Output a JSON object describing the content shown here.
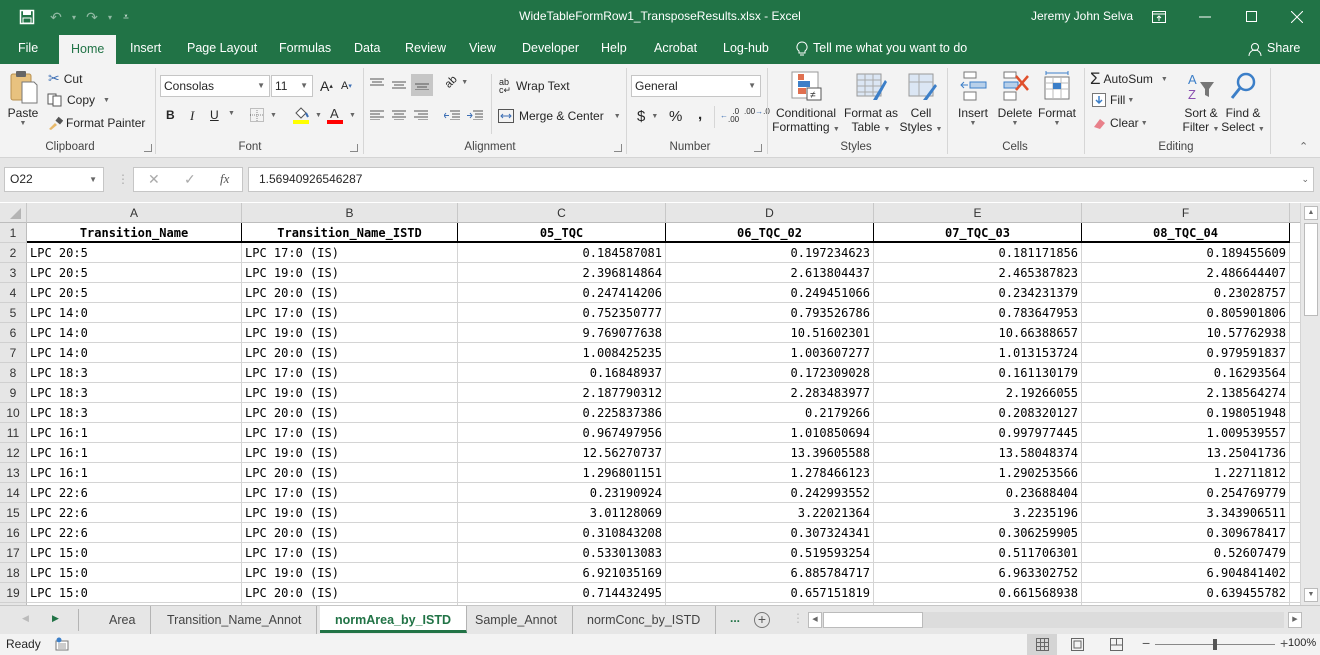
{
  "window": {
    "title": "WideTableFormRow1_TransposeResults.xlsx  -  Excel",
    "user": "Jeremy John Selva"
  },
  "menu": {
    "tabs": [
      "File",
      "Home",
      "Insert",
      "Page Layout",
      "Formulas",
      "Data",
      "Review",
      "View",
      "Developer",
      "Help",
      "Acrobat",
      "Log-hub"
    ],
    "tell_me": "Tell me what you want to do",
    "share": "Share",
    "active": "Home"
  },
  "ribbon": {
    "clipboard": {
      "paste": "Paste",
      "cut": "Cut",
      "copy": "Copy",
      "format_painter": "Format Painter",
      "label": "Clipboard"
    },
    "font": {
      "name": "Consolas",
      "size": "11",
      "bold": "B",
      "italic": "I",
      "underline": "U",
      "label": "Font"
    },
    "alignment": {
      "wrap_text": "Wrap Text",
      "merge_center": "Merge & Center",
      "label": "Alignment"
    },
    "number": {
      "format": "General",
      "currency": "$",
      "percent": "%",
      "comma": ",",
      "label": "Number"
    },
    "styles": {
      "conditional": "Conditional",
      "conditional2": "Formatting",
      "format_table": "Format as",
      "format_table2": "Table",
      "cell_styles": "Cell",
      "cell_styles2": "Styles",
      "label": "Styles"
    },
    "cells": {
      "insert": "Insert",
      "delete": "Delete",
      "format": "Format",
      "label": "Cells"
    },
    "editing": {
      "autosum": "AutoSum",
      "fill": "Fill",
      "clear": "Clear",
      "sort": "Sort &",
      "sort2": "Filter",
      "find": "Find &",
      "find2": "Select",
      "label": "Editing"
    }
  },
  "formula_bar": {
    "name_box": "O22",
    "formula": "1.56940926546287"
  },
  "sheet": {
    "columns": [
      "A",
      "B",
      "C",
      "D",
      "E",
      "F"
    ],
    "headers": [
      "Transition_Name",
      "Transition_Name_ISTD",
      "05_TQC",
      "06_TQC_02",
      "07_TQC_03",
      "08_TQC_04"
    ],
    "rows": [
      [
        "LPC 20:5",
        "LPC 17:0 (IS)",
        "0.184587081",
        "0.197234623",
        "0.181171856",
        "0.189455609"
      ],
      [
        "LPC 20:5",
        "LPC 19:0 (IS)",
        "2.396814864",
        "2.613804437",
        "2.465387823",
        "2.486644407"
      ],
      [
        "LPC 20:5",
        "LPC 20:0 (IS)",
        "0.247414206",
        "0.249451066",
        "0.234231379",
        "0.23028757"
      ],
      [
        "LPC 14:0",
        "LPC 17:0 (IS)",
        "0.752350777",
        "0.793526786",
        "0.783647953",
        "0.805901806"
      ],
      [
        "LPC 14:0",
        "LPC 19:0 (IS)",
        "9.769077638",
        "10.51602301",
        "10.66388657",
        "10.57762938"
      ],
      [
        "LPC 14:0",
        "LPC 20:0 (IS)",
        "1.008425235",
        "1.003607277",
        "1.013153724",
        "0.979591837"
      ],
      [
        "LPC 18:3",
        "LPC 17:0 (IS)",
        "0.16848937",
        "0.172309028",
        "0.161130179",
        "0.16293564"
      ],
      [
        "LPC 18:3",
        "LPC 19:0 (IS)",
        "2.187790312",
        "2.283483977",
        "2.19266055",
        "2.138564274"
      ],
      [
        "LPC 18:3",
        "LPC 20:0 (IS)",
        "0.225837386",
        "0.2179266",
        "0.208320127",
        "0.198051948"
      ],
      [
        "LPC 16:1",
        "LPC 17:0 (IS)",
        "0.967497956",
        "1.010850694",
        "0.997977445",
        "1.009539557"
      ],
      [
        "LPC 16:1",
        "LPC 19:0 (IS)",
        "12.56270737",
        "13.39605588",
        "13.58048374",
        "13.25041736"
      ],
      [
        "LPC 16:1",
        "LPC 20:0 (IS)",
        "1.296801151",
        "1.278466123",
        "1.290253566",
        "1.22711812"
      ],
      [
        "LPC 22:6",
        "LPC 17:0 (IS)",
        "0.23190924",
        "0.242993552",
        "0.23688404",
        "0.254769779"
      ],
      [
        "LPC 22:6",
        "LPC 19:0 (IS)",
        "3.01128069",
        "3.22021364",
        "3.2235196",
        "3.343906511"
      ],
      [
        "LPC 22:6",
        "LPC 20:0 (IS)",
        "0.310843208",
        "0.307324341",
        "0.306259905",
        "0.309678417"
      ],
      [
        "LPC 15:0",
        "LPC 17:0 (IS)",
        "0.533013083",
        "0.519593254",
        "0.511706301",
        "0.52607479"
      ],
      [
        "LPC 15:0",
        "LPC 19:0 (IS)",
        "6.921035169",
        "6.885784717",
        "6.963302752",
        "6.904841402"
      ],
      [
        "LPC 15:0",
        "LPC 20:0 (IS)",
        "0.714432495",
        "0.657151819",
        "0.661568938",
        "0.639455782"
      ]
    ]
  },
  "sheet_tabs": {
    "tabs": [
      "Area",
      "Transition_Name_Annot",
      "normArea_by_ISTD",
      "Sample_Annot",
      "normConc_by_ISTD"
    ],
    "active": "normArea_by_ISTD",
    "more": "..."
  },
  "status": {
    "ready": "Ready",
    "zoom": "100%",
    "zoom_percent": 100
  }
}
